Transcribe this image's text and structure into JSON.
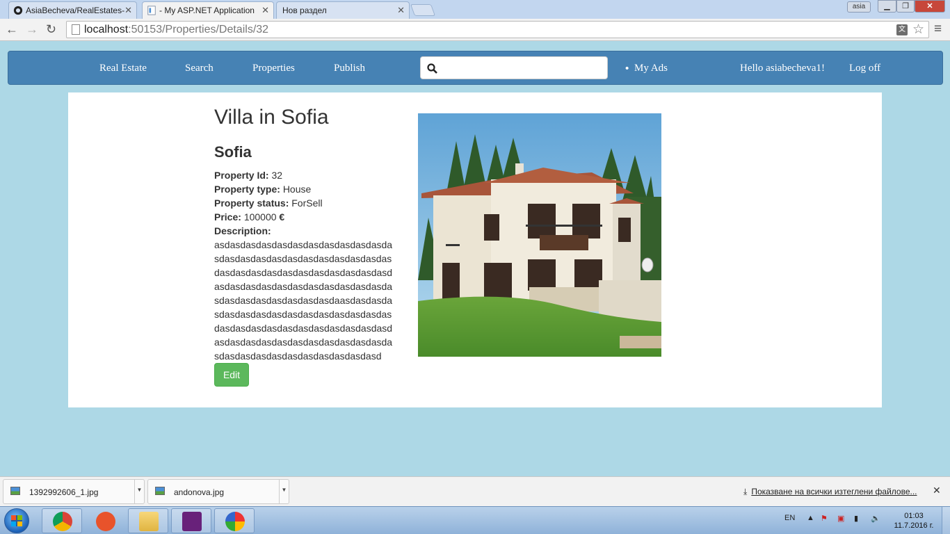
{
  "browser": {
    "tabs": [
      {
        "label": "AsiaBecheva/RealEstates-"
      },
      {
        "label": "- My ASP.NET Application"
      },
      {
        "label": "Нов раздел"
      }
    ],
    "user_badge": "asia",
    "address": {
      "host": "localhost",
      "path": ":50153/Properties/Details/32"
    }
  },
  "navbar": {
    "brand": "Real Estate",
    "links": [
      "Search",
      "Properties",
      "Publish"
    ],
    "search": {
      "placeholder": "",
      "value": ""
    },
    "my_ads": "My Ads",
    "greeting": "Hello asiabecheva1!",
    "logoff": "Log off"
  },
  "property": {
    "title": "Villa in Sofia",
    "city": "Sofia",
    "fields": [
      {
        "label": "Property Id:",
        "value": "32"
      },
      {
        "label": "Property type:",
        "value": "House"
      },
      {
        "label": "Property status:",
        "value": "ForSell"
      },
      {
        "label": "Price:",
        "value": "100000"
      }
    ],
    "currency": "€",
    "description_label": "Description:",
    "description": "asdasdasdasdasdasdasdasdasdasdasdasdasdasdasdasdasdasdasdasdasdasdasdasdasdasdasdasdasdasdasdasdasdasdasdasdasdasdasdasdasdasdasdasdasdasdasdasdasdasdasdasdasdaasdasdasdasdasdasdasdasdasdasdasdasdasdasdasdasdasdasdasdasdasdasdasdasdasdasdasdasdasdasdasdasdasdasdasdasdasdasdasdasdasdasdasdasdasdasdasdasd",
    "edit_label": "Edit"
  },
  "downloads": {
    "items": [
      "1392992606_1.jpg",
      "andonova.jpg"
    ],
    "show_all": "Показване на всички изтеглени файлове..."
  },
  "taskbar": {
    "lang": "EN",
    "time": "01:03",
    "date": "11.7.2016 г."
  },
  "colors": {
    "page_bg": "#add8e6",
    "navbar": "#4682b4",
    "edit_button": "#5cb85c"
  }
}
